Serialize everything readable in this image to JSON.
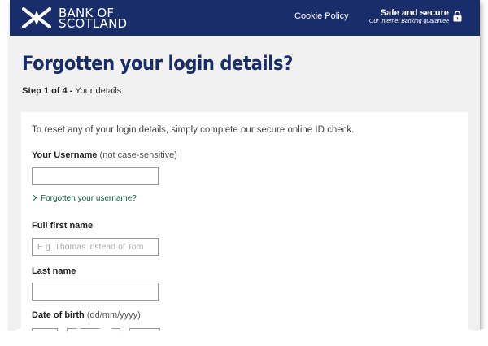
{
  "header": {
    "brand_line1": "BANK OF",
    "brand_line2": "SCOTLAND",
    "cookie_policy": "Cookie Policy",
    "safe_title": "Safe and secure",
    "safe_subtitle": "Our Internet Banking guarantee"
  },
  "page": {
    "title": "Forgotten your login details?",
    "step_bold": "Step 1 of 4 -",
    "step_text": " Your details"
  },
  "form": {
    "intro": "To reset any of your login details, simply complete our secure online ID check.",
    "username_label": "Your Username",
    "username_hint": " (not case-sensitive)",
    "username_value": "",
    "forgot_username": "Forgotten your username?",
    "first_name_label": "Full first name",
    "first_name_placeholder": "E.g. Thomas instead of Tom",
    "last_name_label": "Last name",
    "last_name_value": "",
    "dob_label": "Date of birth",
    "dob_hint": " (dd/mm/yyyy)"
  },
  "colors": {
    "brand_navy": "#1a2d6b",
    "link_green": "#0b5c3b",
    "page_bg": "#f1f1f1"
  },
  "icons": [
    "saltire-logo-icon",
    "padlock-icon",
    "chevron-right-icon"
  ]
}
